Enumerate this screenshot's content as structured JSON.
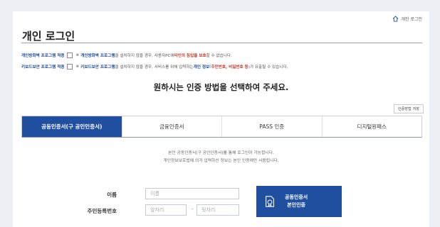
{
  "header": {
    "home_label": "개인 로그인"
  },
  "page": {
    "title": "개인 로그인"
  },
  "options": [
    {
      "label": "개인방화벽 프로그램 적용",
      "mark": "※",
      "p1": "개인방화벽 프로그램",
      "p2": "을 설치하지 않을 경우, 사용자PC에",
      "p3": "타인의 침입을 보호",
      "p4": "할 수 없습니다.",
      "p5": "",
      "p6": ""
    },
    {
      "label": "키보드보안 프로그램 적용",
      "mark": "※",
      "p1": "키보드보안 프로그램",
      "p2": "을 설치하지 않을 경우, 서비스를 위해 입력하는",
      "p3": "개인 정보",
      "p4": "(",
      "p5": "주민번호, 비밀번호 등",
      "p6": ")가 유출될 수 있습니다."
    }
  ],
  "main": {
    "heading": "원하시는 인증 방법을 선택하여 주세요.",
    "howto_button": "인증방법 저장"
  },
  "tabs": [
    {
      "label": "공동인증서(구 공인인증서)",
      "active": true
    },
    {
      "label": "금융인증서",
      "active": false
    },
    {
      "label": "PASS 인증",
      "active": false
    },
    {
      "label": "디지털원패스",
      "active": false
    }
  ],
  "info": {
    "line1": "본인 공동인증서(구 공인인증서)를 통해 로그인이 가능합니다.",
    "line2": "개인정보보호법에 의거 입력하신 정보는 본인 인증에만 사용됩니다."
  },
  "form": {
    "name_label": "이름",
    "name_placeholder": "이름",
    "rrn_label": "주민등록번호",
    "rrn_front_placeholder": "앞자리",
    "rrn_dash": "-",
    "rrn_back_placeholder": "뒷자리"
  },
  "cert_button": {
    "line1": "공동인증서",
    "line2": "본인인증"
  },
  "colors": {
    "primary": "#1f4f9e",
    "link": "#1e4a9e",
    "alert": "#c0392b"
  }
}
